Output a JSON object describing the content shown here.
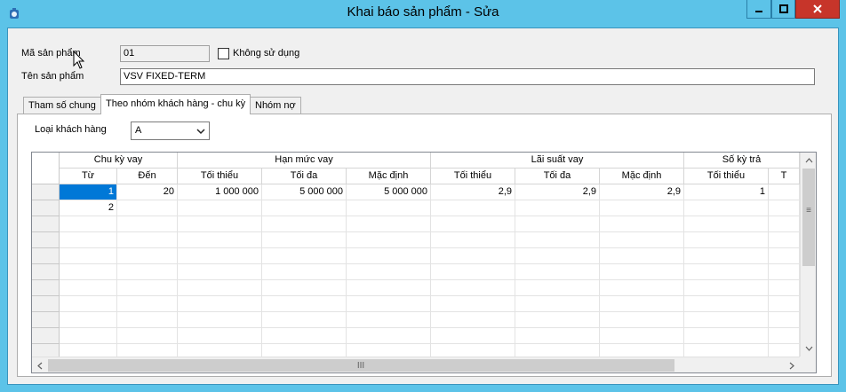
{
  "window": {
    "title": "Khai báo sản phẩm - Sửa",
    "icons": {
      "app": "app-icon",
      "minimize": "minimize-icon",
      "maximize": "maximize-icon",
      "close": "close-icon"
    }
  },
  "form": {
    "product_code_label": "Mã sản phẩm",
    "product_code_value": "01",
    "not_used_label": "Không sử dụng",
    "not_used_checked": false,
    "product_name_label": "Tên sản phẩm",
    "product_name_value": "VSV FIXED-TERM"
  },
  "tabs": [
    {
      "label": "Tham số chung",
      "active": false
    },
    {
      "label": "Theo nhóm khách hàng - chu kỳ",
      "active": true
    },
    {
      "label": "Nhóm nợ",
      "active": false
    }
  ],
  "customer_type": {
    "label": "Loại khách hàng",
    "value": "A"
  },
  "grid": {
    "group_headers": [
      "Chu kỳ vay",
      "Hạn mức vay",
      "Lãi suất vay",
      "Số kỳ trả"
    ],
    "columns": [
      "Từ",
      "Đến",
      "Tối thiểu",
      "Tối đa",
      "Mặc định",
      "Tối thiểu",
      "Tối đa",
      "Mặc định",
      "Tối thiểu",
      "T"
    ],
    "rows": [
      [
        "1",
        "20",
        "1 000 000",
        "5 000 000",
        "5 000 000",
        "2,9",
        "2,9",
        "2,9",
        "1",
        ""
      ],
      [
        "2",
        "",
        "",
        "",
        "",
        "",
        "",
        "",
        "",
        ""
      ]
    ],
    "selected_cell": {
      "row": 0,
      "col": 0
    },
    "hscroll_grip": "III",
    "vscroll_grip": "≡"
  }
}
